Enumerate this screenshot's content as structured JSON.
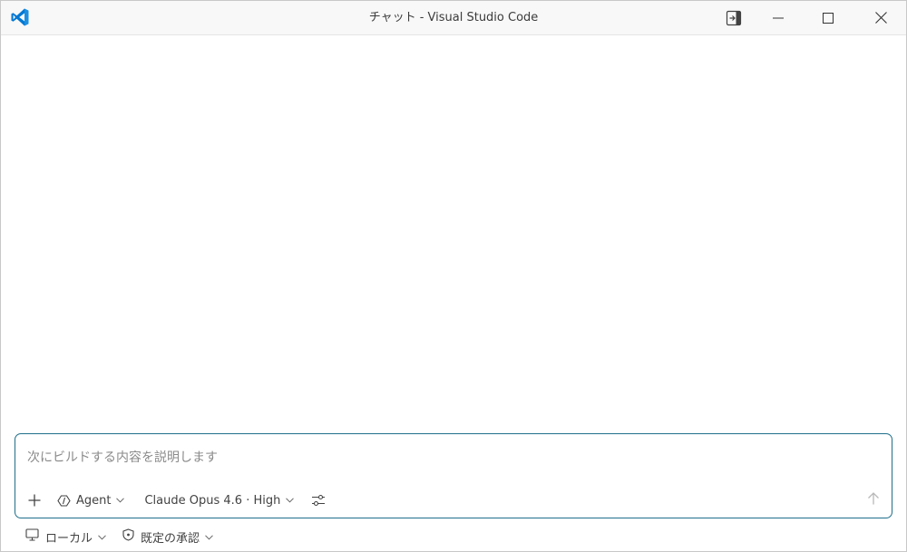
{
  "window": {
    "title": "チャット - Visual Studio Code"
  },
  "chat": {
    "placeholder": "次にビルドする内容を説明します",
    "value": "",
    "mode_label": "Agent",
    "model_label": "Claude Opus 4.6 · High"
  },
  "status": {
    "location_label": "ローカル",
    "approval_label": "既定の承認"
  },
  "colors": {
    "accent_border": "#1f6f8b",
    "brand_blue": "#0078d4"
  },
  "icons": {
    "logo": "vscode-logo",
    "layout": "toggle-editor-icon",
    "add": "plus-icon",
    "agent": "agent-icon",
    "settings": "sliders-icon",
    "send": "arrow-up-icon",
    "location": "monitor-icon",
    "approval": "shield-icon"
  }
}
